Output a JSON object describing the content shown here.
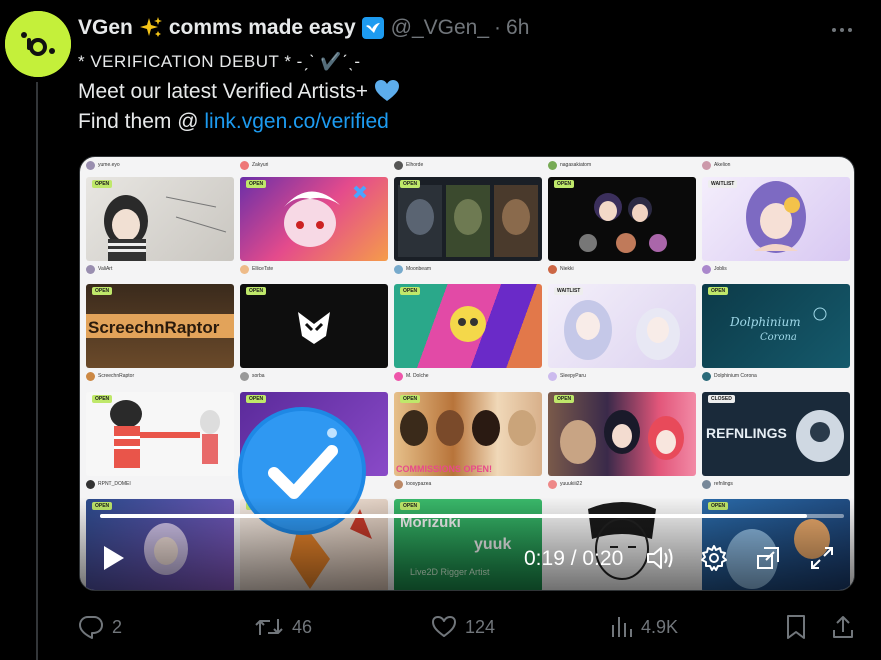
{
  "tweet": {
    "display_name": "VGen",
    "display_name_suffix": "comms made easy",
    "handle": "@_VGen_",
    "separator": "·",
    "time": "6h",
    "line1": "* VERIFICATION DEBUT * -ˏˋ ✔️ˊˎ-",
    "line2": "Meet our latest Verified Artists+",
    "line3_prefix": "Find them @",
    "link": "link.vgen.co/verified"
  },
  "video": {
    "time": "0:19 / 0:20",
    "progress": 0.95,
    "artists": [
      "yume.eyo",
      "Zakyuri",
      "Elhorde",
      "nagasakiatom",
      "Akelion",
      "ValiArt",
      "ElliceTste",
      "Moonbeam",
      "Niekki",
      "Joblis",
      "ScreechnRaptor",
      "sorba",
      "M. Dolche",
      "SleepyParu",
      "Dolphinium Corona",
      "RPNT_DOMEI",
      "",
      "loosypazea",
      "yuuukiii22",
      "refnlings"
    ],
    "tags": [
      "OPEN",
      "WAITLIST",
      "CLOSED"
    ],
    "thumb_texts": [
      "ScreechnRaptor",
      "REFNLINGS",
      "COMMISSIONS OPEN!",
      "Morizuki",
      "yuuk",
      "Live2D Rigger Artist",
      "Dolphinium Corona"
    ]
  },
  "actions": {
    "replies": "2",
    "retweets": "46",
    "likes": "124",
    "views": "4.9K"
  },
  "colors": {
    "accent": "#1d9bf0",
    "avatar_bg": "#c4f03a",
    "muted": "#71767b",
    "text": "#e7e9ea"
  }
}
